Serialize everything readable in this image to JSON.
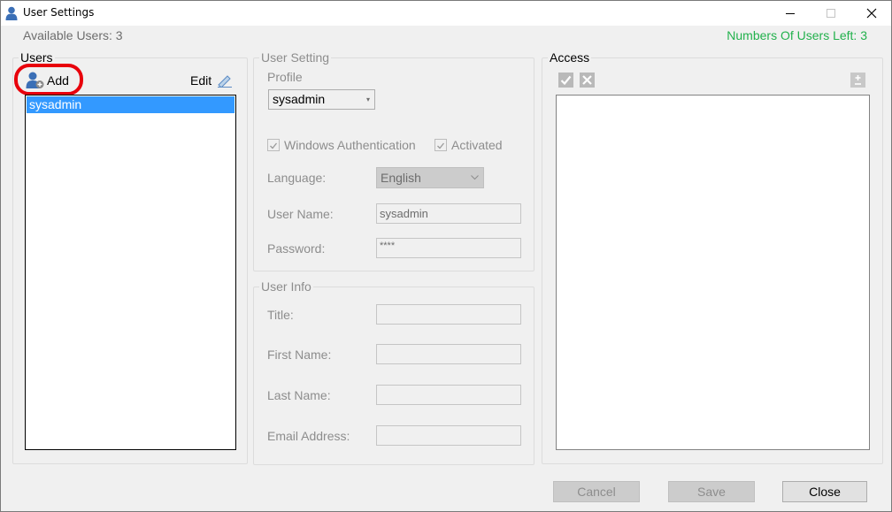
{
  "window": {
    "title": "User Settings",
    "icon": "user-icon",
    "controls": [
      "minimize-icon",
      "maximize-icon",
      "close-icon"
    ]
  },
  "header": {
    "available_users": "Available Users: 3",
    "users_left": "Numbers Of Users Left: 3",
    "users_left_color": "#22b14c"
  },
  "users_group": {
    "legend": "Users",
    "add_label": "Add",
    "edit_label": "Edit",
    "items": [
      "sysadmin"
    ],
    "highlight_color": "#e8000b"
  },
  "user_setting": {
    "legend": "User Setting",
    "profile_label": "Profile",
    "profile_value": "sysadmin",
    "windows_auth_label": "Windows Authentication",
    "activated_label": "Activated",
    "language_label": "Language:",
    "language_value": "English",
    "username_label": "User Name:",
    "username_value": "sysadmin",
    "password_label": "Password:",
    "password_value": "****"
  },
  "user_info": {
    "legend": "User Info",
    "title_label": "Title:",
    "first_name_label": "First Name:",
    "last_name_label": "Last Name:",
    "email_label": "Email Address:"
  },
  "access": {
    "legend": "Access"
  },
  "footer": {
    "cancel_label": "Cancel",
    "save_label": "Save",
    "close_label": "Close"
  }
}
